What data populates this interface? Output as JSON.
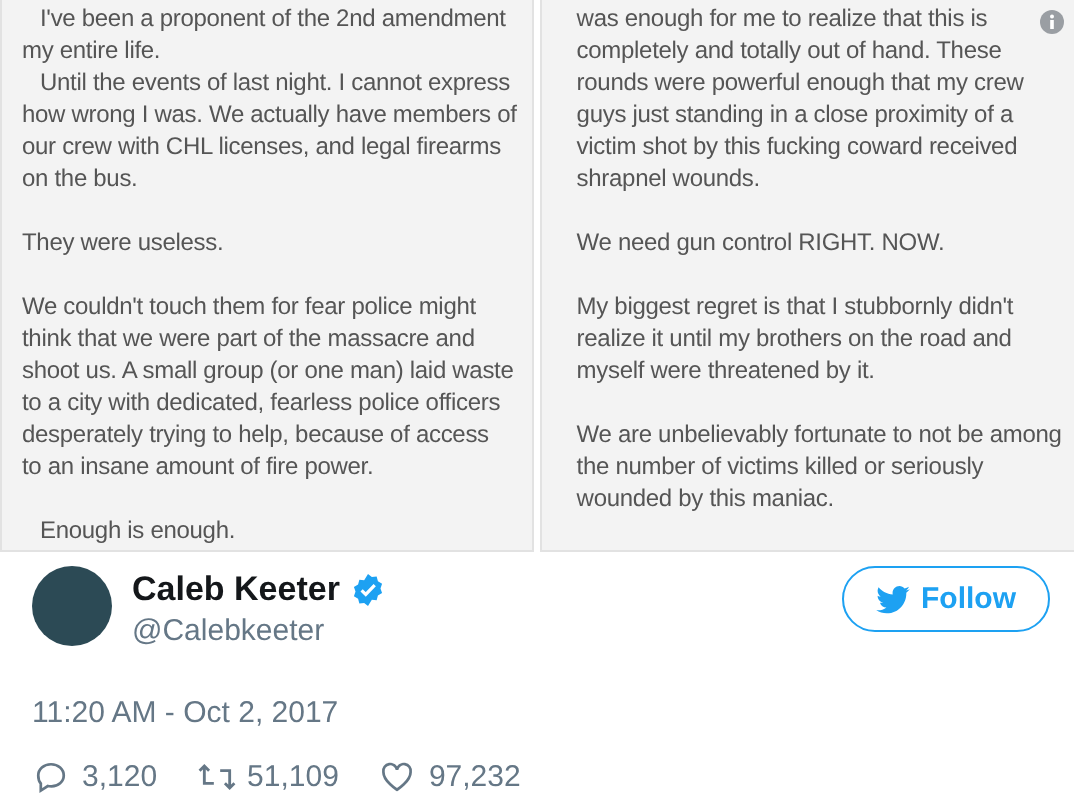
{
  "note_images": [
    {
      "paragraphs": [
        {
          "lines": [
            {
              "text": "I've been a proponent of the 2nd amendment",
              "indent": true
            },
            {
              "text": "my entire life.",
              "indent": false
            },
            {
              "text": "Until the events of last night. I cannot express",
              "indent": true
            },
            {
              "text": "how wrong I was. We actually have members of",
              "indent": false
            },
            {
              "text": "our crew with CHL licenses, and legal firearms",
              "indent": false
            },
            {
              "text": "on the bus.",
              "indent": false
            }
          ]
        },
        {
          "lines": [
            {
              "text": "They were useless.",
              "indent": false
            }
          ]
        },
        {
          "lines": [
            {
              "text": "We couldn't touch them for fear police might",
              "indent": false
            },
            {
              "text": "think that we were part of the massacre and",
              "indent": false
            },
            {
              "text": "shoot us. A small group (or one man) laid waste",
              "indent": false
            },
            {
              "text": "to a city with dedicated, fearless police officers",
              "indent": false
            },
            {
              "text": "desperately trying to help, because of access",
              "indent": false
            },
            {
              "text": "to an insane amount of fire power.",
              "indent": false
            }
          ]
        },
        {
          "lines": [
            {
              "text": "Enough is enough.",
              "indent": true
            }
          ]
        }
      ]
    },
    {
      "paragraphs": [
        {
          "lines": [
            {
              "text": "was enough for me to realize that this is",
              "indent": false
            },
            {
              "text": "completely and totally out of hand. These",
              "indent": false
            },
            {
              "text": "rounds were powerful enough that my crew",
              "indent": false
            },
            {
              "text": "guys just standing in a close proximity of a",
              "indent": false
            },
            {
              "text": "victim shot by this fucking coward received",
              "indent": false
            },
            {
              "text": "shrapnel wounds.",
              "indent": false
            }
          ]
        },
        {
          "lines": [
            {
              "text": "We need gun control RIGHT. NOW.",
              "indent": false
            }
          ]
        },
        {
          "lines": [
            {
              "text": "My biggest regret is that I stubbornly didn't",
              "indent": false
            },
            {
              "text": "realize it until my brothers on the road and",
              "indent": false
            },
            {
              "text": "myself were threatened by it.",
              "indent": false
            }
          ]
        },
        {
          "lines": [
            {
              "text": "We are unbelievably fortunate to not be among",
              "indent": false
            },
            {
              "text": "the number of victims killed or seriously",
              "indent": false
            },
            {
              "text": "wounded by this maniac.",
              "indent": false
            }
          ]
        }
      ]
    }
  ],
  "author": {
    "name": "Caleb Keeter",
    "verified": true,
    "handle": "@Calebkeeter"
  },
  "follow_button": "Follow",
  "timestamp": "11:20 AM - Oct 2, 2017",
  "stats": [
    {
      "kind": "reply",
      "count": "3,120"
    },
    {
      "kind": "retweet",
      "count": "51,109"
    },
    {
      "kind": "like",
      "count": "97,232"
    }
  ]
}
